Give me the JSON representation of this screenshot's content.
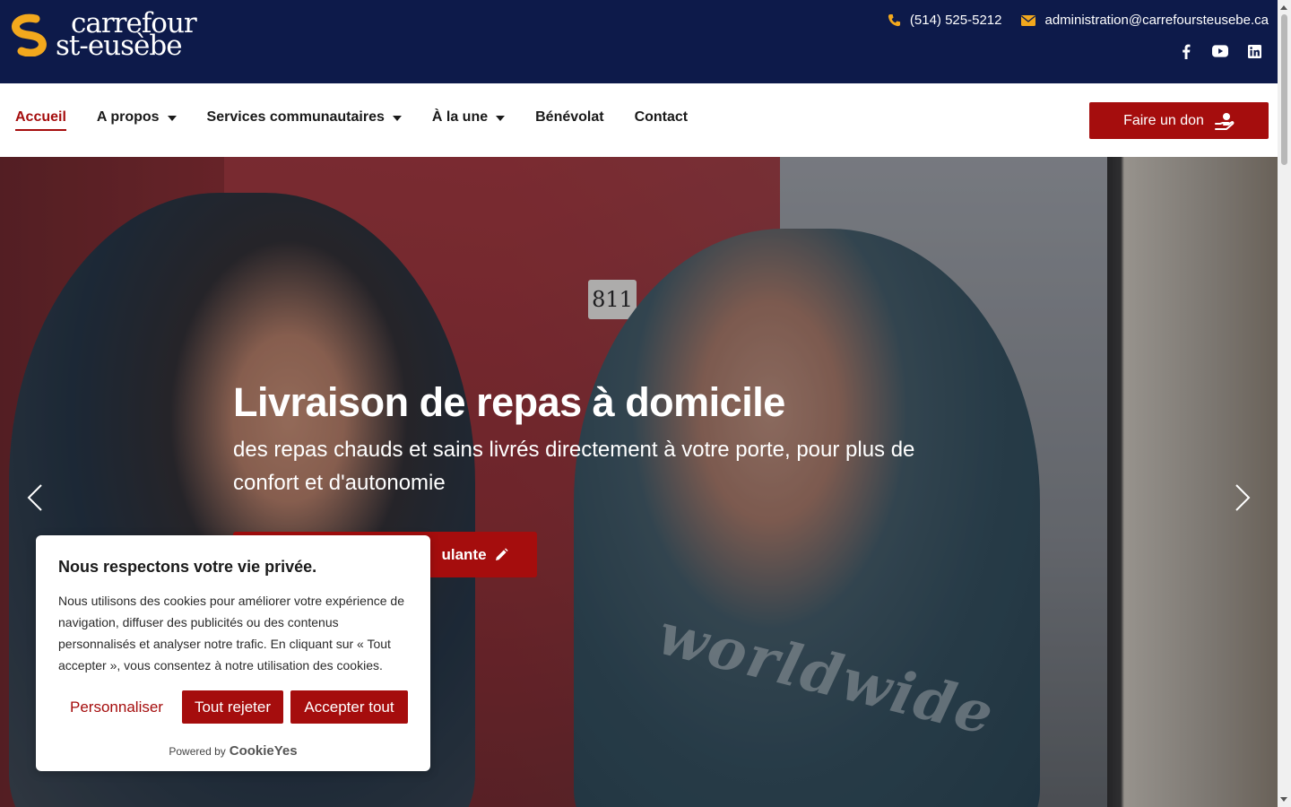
{
  "header": {
    "logo": {
      "line1": "carrefour",
      "line2": "st-eusèbe"
    },
    "phone": "(514) 525-5212",
    "email": "administration@carrefoursteusebe.ca",
    "socials": [
      "facebook-icon",
      "youtube-icon",
      "linkedin-icon"
    ]
  },
  "nav": {
    "items": [
      {
        "label": "Accueil",
        "active": true
      },
      {
        "label": "A propos",
        "has_dropdown": true
      },
      {
        "label": "Services communautaires",
        "has_dropdown": true
      },
      {
        "label": "À la une",
        "has_dropdown": true
      },
      {
        "label": "Bénévolat"
      },
      {
        "label": "Contact"
      }
    ],
    "donate_label": "Faire un don"
  },
  "hero": {
    "title": "Livraison de repas à domicile",
    "subtitle": "des repas chauds et sains livrés directement à votre porte, pour plus de confort et d'autonomie",
    "button_label": "ulante",
    "door_number": "811",
    "shirt_text": "worldwide"
  },
  "cookie": {
    "title": "Nous respectons votre vie privée.",
    "body": "Nous utilisons des cookies pour améliorer votre expérience de navigation, diffuser des publicités ou des contenus personnalisés et analyser notre trafic. En cliquant sur « Tout accepter », vous consentez à notre utilisation des cookies.",
    "customize_label": "Personnaliser",
    "reject_label": "Tout rejeter",
    "accept_label": "Accepter tout",
    "powered_by": "Powered by",
    "powered_brand": "CookieYes"
  },
  "colors": {
    "navy": "#0d1a4a",
    "accent_red": "#a50d0d",
    "gold": "#f2a81d"
  }
}
